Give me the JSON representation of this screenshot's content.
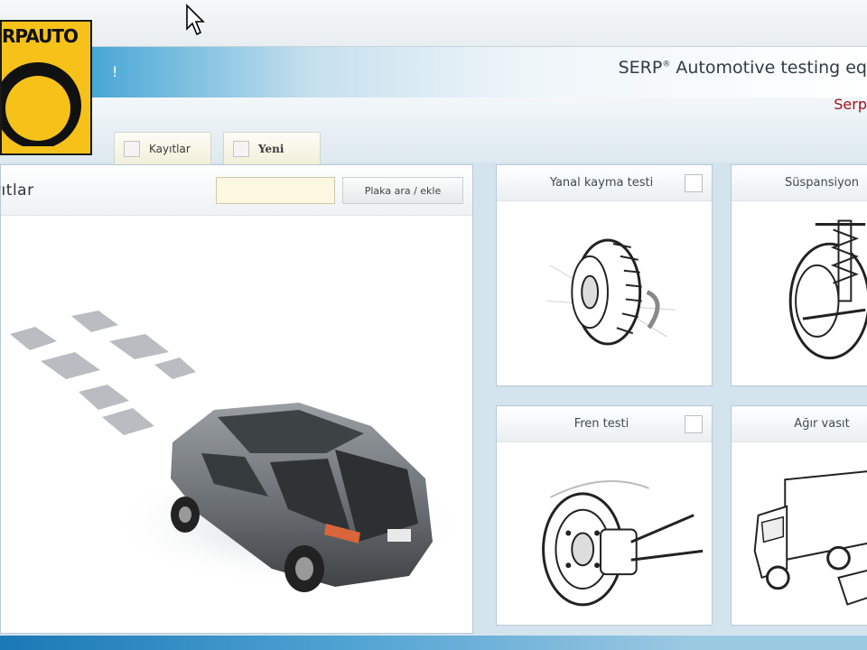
{
  "brand": {
    "logo_text": "RPAUTO",
    "title_main": "SERP",
    "title_reg": "®",
    "title_rest": "Automotive testing eq",
    "subtitle": "Serp",
    "banner_mark": "!"
  },
  "tabs": [
    {
      "label": "Kayıtlar"
    },
    {
      "label": "Yeni"
    }
  ],
  "records_panel": {
    "title": "yıtlar",
    "search_value": "",
    "search_button": "Plaka ara / ekle"
  },
  "tests": [
    {
      "label": "Yanal kayma testi",
      "checked": false
    },
    {
      "label": "Süspansiyon",
      "checked": false
    },
    {
      "label": "Fren testi",
      "checked": false
    },
    {
      "label": "Ağır vasıt",
      "checked": false
    }
  ],
  "colors": {
    "logo_yellow": "#f6c21a",
    "banner_blue": "#1f8fc7",
    "subtitle_red": "#a0101a",
    "car_gray": "#6f7478"
  },
  "icons": {
    "cursor": "arrow-cursor-icon",
    "tire": "tire-icon",
    "suspension": "suspension-icon",
    "brake": "brake-disc-icon",
    "truck": "truck-icon"
  }
}
